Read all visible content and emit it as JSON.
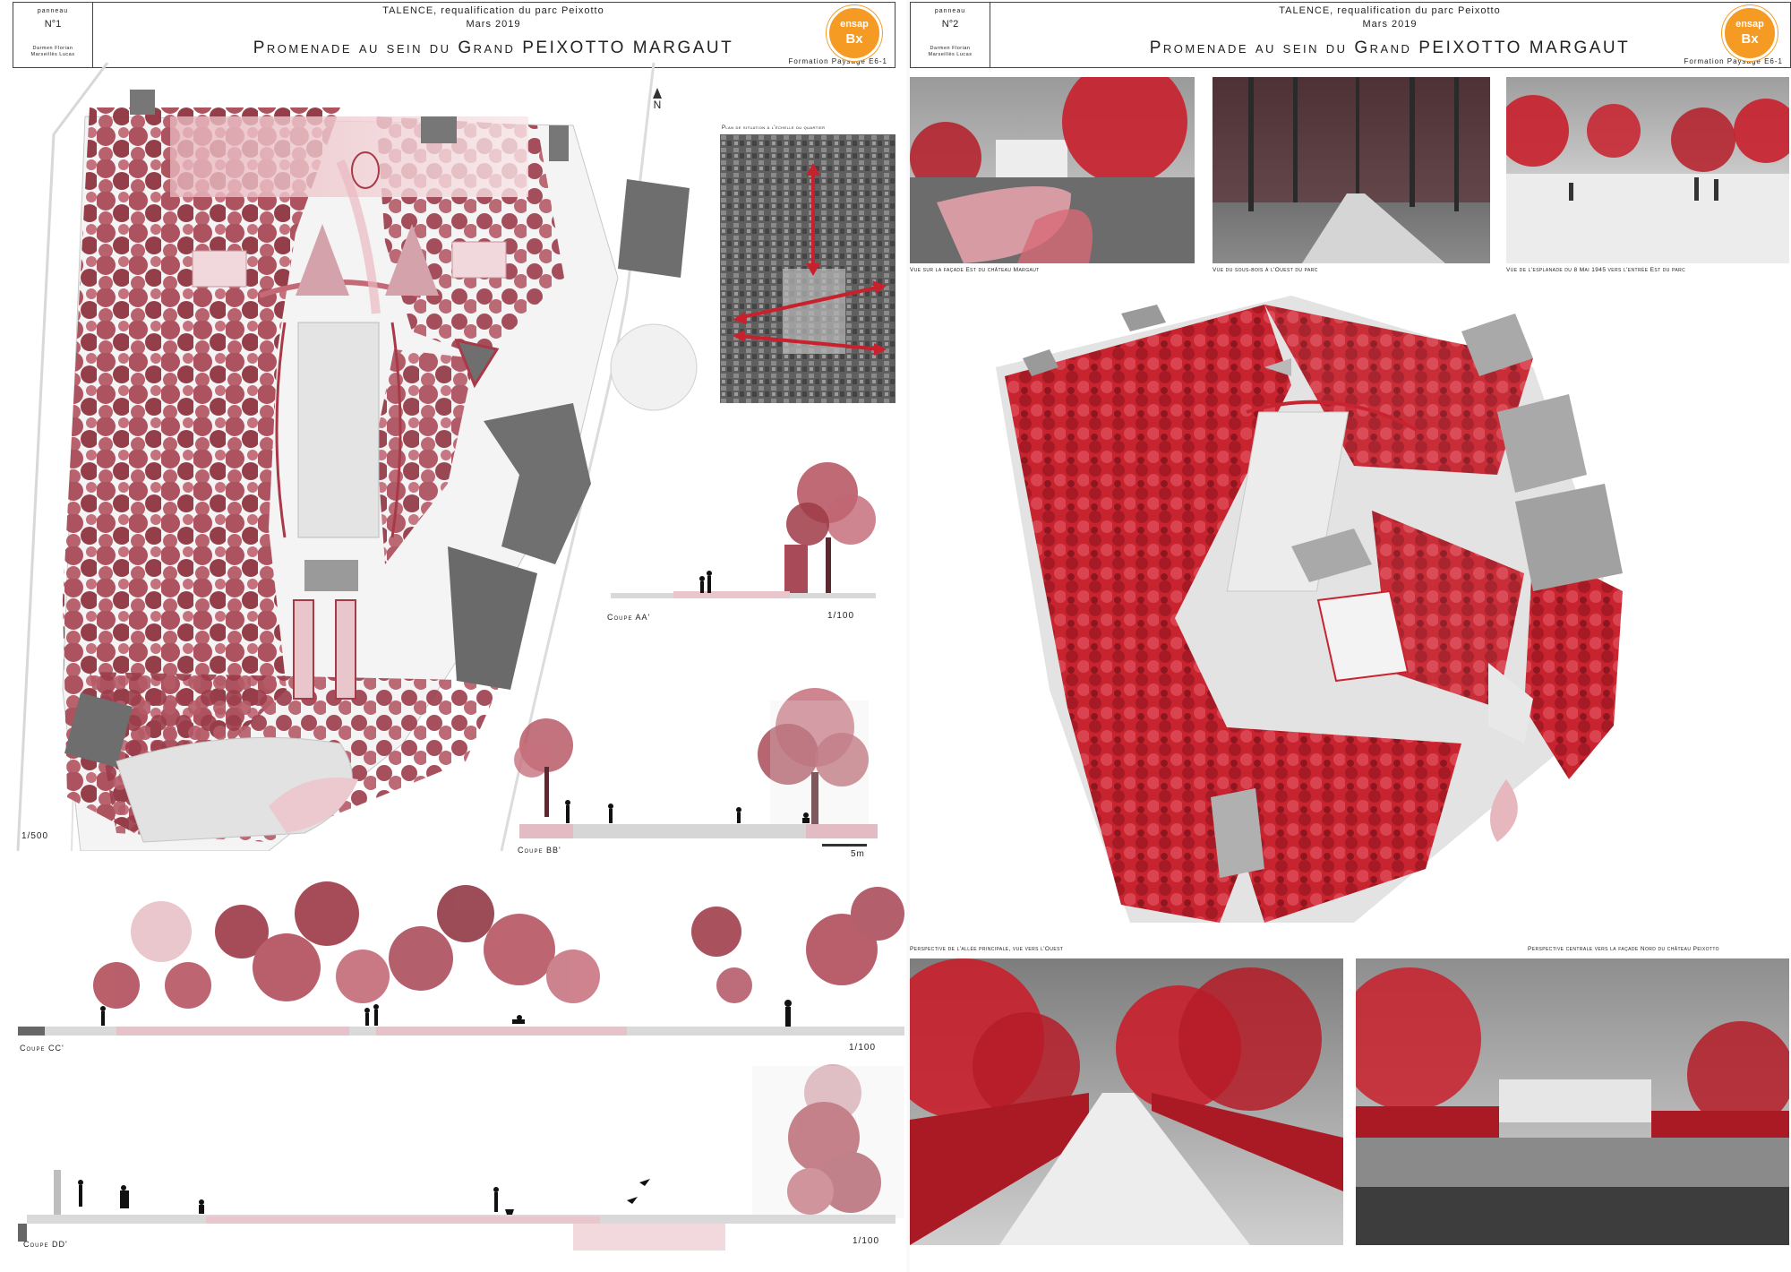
{
  "panels": [
    {
      "id": "panel-1",
      "number_label": "panneau",
      "number": "N°1",
      "authors": [
        "Darmen Florian",
        "Marseillès Lucas"
      ],
      "subtitle": "TALENCE, requalification du parc Peixotto",
      "date": "Mars 2019",
      "title": "Promenade au sein du Grand PEIXOTTO MARGAUT",
      "formation": "Formation Paysage E6-1",
      "logo": {
        "line1": "ensap",
        "line2": "Bx"
      },
      "north_label": "N",
      "situation_caption": "Plan de situation à l'échelle du quartier",
      "plan_scale": "1/500",
      "sections": [
        {
          "label": "Coupe AA'",
          "scale": "1/100"
        },
        {
          "label": "Coupe BB'",
          "scale": "5m"
        },
        {
          "label": "Coupe CC'",
          "scale": "1/100"
        },
        {
          "label": "Coupe DD'",
          "scale": "1/100"
        }
      ]
    },
    {
      "id": "panel-2",
      "number_label": "panneau",
      "number": "N°2",
      "authors": [
        "Darmen Florian",
        "Marseillès Lucas"
      ],
      "subtitle": "TALENCE, requalification du parc Peixotto",
      "date": "Mars 2019",
      "title": "Promenade au sein du Grand PEIXOTTO MARGAUT",
      "formation": "Formation Paysage E6-1",
      "logo": {
        "line1": "ensap",
        "line2": "Bx"
      },
      "photos": [
        {
          "caption": "Vue sur la façade Est du château Margaut"
        },
        {
          "caption": "Vue du sous-bois à l'Ouest du parc"
        },
        {
          "caption": "Vue de l'esplanade du 8 Mai 1945 vers l'entrée Est du parc"
        },
        {
          "caption": "Perspective de l'allée principale, vue vers l'Ouest"
        },
        {
          "caption": "Perspective centrale vers la façade Nord du château Peixotto"
        }
      ]
    }
  ],
  "colors": {
    "accent": "#b8434f",
    "tree": "#9e3a47",
    "red_photo": "#c8202c",
    "building": "#6e6e6e",
    "logo": "#f59a23"
  }
}
